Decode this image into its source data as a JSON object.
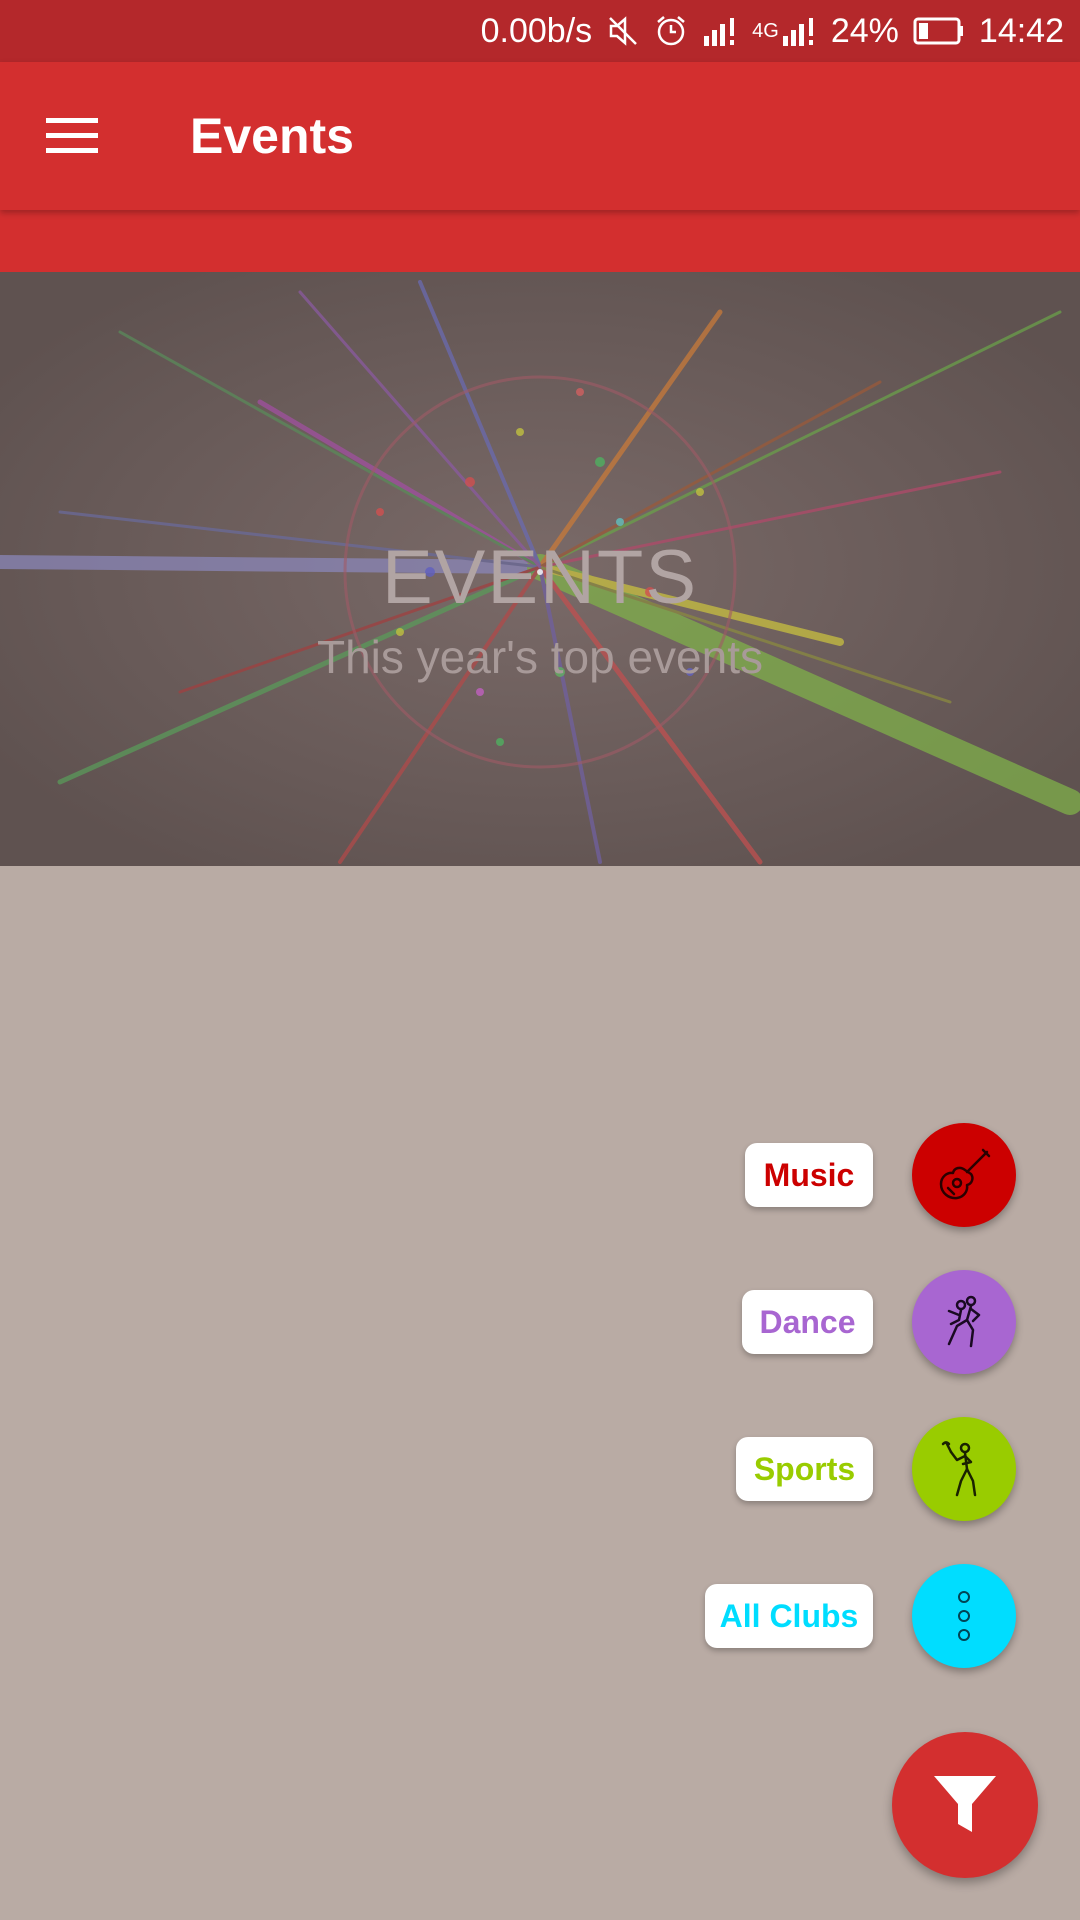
{
  "status_bar": {
    "speed": "0.00b/s",
    "network": "4G",
    "battery": "24%",
    "time": "14:42"
  },
  "app_bar": {
    "title": "Events"
  },
  "hero": {
    "title": "EVENTS",
    "subtitle": "This year's top events"
  },
  "fab_menu": {
    "items": [
      {
        "label": "Music",
        "color": "#cc0000",
        "text_color": "#cc0000",
        "icon": "guitar-icon"
      },
      {
        "label": "Dance",
        "color": "#a866d1",
        "text_color": "#a866d1",
        "icon": "dancing-couple-icon"
      },
      {
        "label": "Sports",
        "color": "#99cc00",
        "text_color": "#99cc00",
        "icon": "golfer-icon"
      },
      {
        "label": "All Clubs",
        "color": "#00ddff",
        "text_color": "#00ddff",
        "icon": "more-vertical-icon"
      }
    ],
    "main_icon": "filter-icon",
    "main_color": "#d32f2f"
  },
  "colors": {
    "primary": "#d32f2f",
    "primary_dark": "#b4282b",
    "scrim": "#b9aba4"
  }
}
